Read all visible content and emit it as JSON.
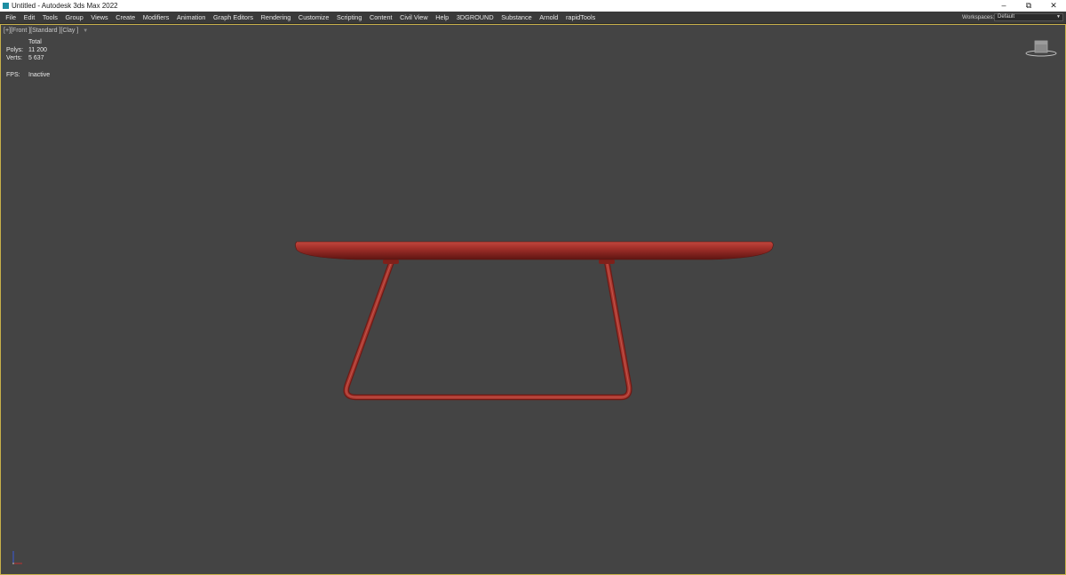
{
  "titlebar": {
    "title": "Untitled - Autodesk 3ds Max 2022",
    "min_glyph": "–",
    "max_glyph": "⧉",
    "close_glyph": "✕"
  },
  "menu": {
    "items": [
      {
        "label": "File"
      },
      {
        "label": "Edit"
      },
      {
        "label": "Tools"
      },
      {
        "label": "Group"
      },
      {
        "label": "Views"
      },
      {
        "label": "Create"
      },
      {
        "label": "Modifiers"
      },
      {
        "label": "Animation"
      },
      {
        "label": "Graph Editors"
      },
      {
        "label": "Rendering"
      },
      {
        "label": "Customize"
      },
      {
        "label": "Scripting"
      },
      {
        "label": "Content"
      },
      {
        "label": "Civil View"
      },
      {
        "label": "Help"
      },
      {
        "label": "3DGROUND"
      },
      {
        "label": "Substance"
      },
      {
        "label": "Arnold"
      },
      {
        "label": "rapidTools"
      }
    ],
    "workspace_label": "Workspaces:",
    "workspace_value": "Default"
  },
  "viewport": {
    "label_plus": "[+]",
    "label_view": "[Front ]",
    "label_shading": "[Standard ]",
    "label_mode": "[Clay ]",
    "filter_glyph": "▼",
    "stats": {
      "header": "Total",
      "polys_label": "Polys:",
      "polys_value": "11 200",
      "verts_label": "Verts:",
      "verts_value": "5 637",
      "fps_label": "FPS:",
      "fps_value": "Inactive"
    }
  },
  "colors": {
    "viewport_bg": "#444444",
    "active_border": "#c8b04a",
    "model_red": "#9a2a22",
    "menubar_bg": "#3a3a3a"
  },
  "icons": {
    "viewcube": "viewcube-icon",
    "axis": "axis-tripod-icon",
    "app": "3dsmax-app-icon"
  }
}
